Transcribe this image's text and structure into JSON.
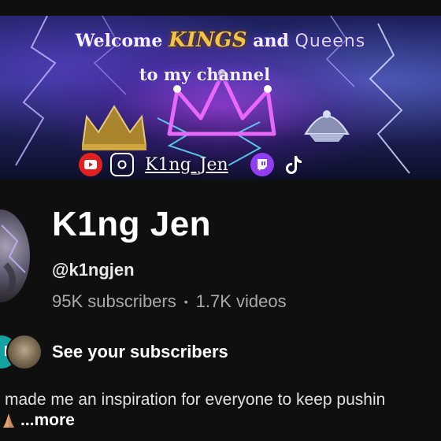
{
  "banner": {
    "welcome": "Welcome",
    "kings": "KINGS",
    "and": "and",
    "queens": "Queens",
    "line2": "to my channel",
    "social_handle": "K1ng_Jen"
  },
  "channel": {
    "name": "K1ng Jen",
    "handle": "@k1ngjen",
    "subscribers": "95K subscribers",
    "separator": "•",
    "videos": "1.7K videos"
  },
  "subscribers_row": {
    "avatar_letter": "I",
    "label": "See your subscribers"
  },
  "description": {
    "text": "made me an inspiration for everyone to keep pushin",
    "more": "...more"
  },
  "colors": {
    "background": "#0f0f0f",
    "teal_avatar": "#12a3a3",
    "youtube_red": "#e12020",
    "twitch_purple": "#8f3ff0",
    "gold": "#f2c24a"
  }
}
